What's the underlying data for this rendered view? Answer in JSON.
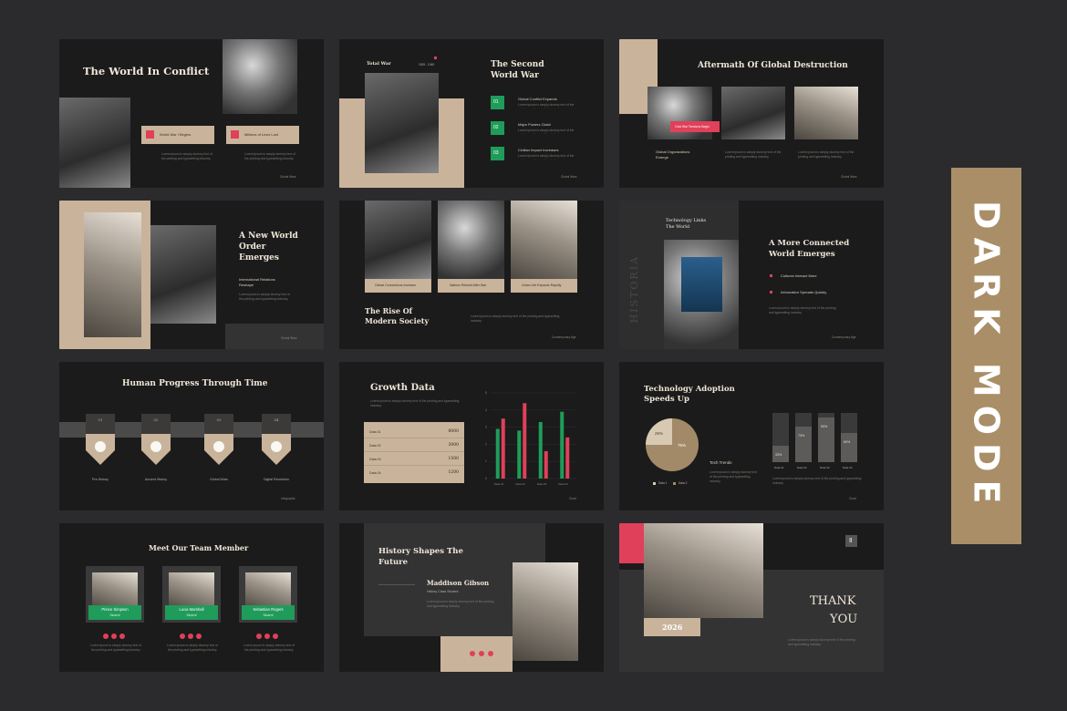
{
  "side_label": "DARK MODE",
  "s1": {
    "title": "The World In Conflict",
    "card1": "World War I Begins",
    "card2": "Millions of Lives Lost",
    "footer": "Global Wars"
  },
  "s2": {
    "tag": "Total War",
    "date": "1939 - 1945",
    "title_line1": "The Second",
    "title_line2": "World War",
    "items": [
      {
        "num": "01",
        "label": "Global Conflict Expands"
      },
      {
        "num": "02",
        "label": "Major Powers Clash"
      },
      {
        "num": "03",
        "label": "Civilian Impact Increases"
      }
    ],
    "footer": "Global Wars"
  },
  "s3": {
    "title": "Aftermath Of Global Destruction",
    "button": "Cold War Tensions Begin",
    "caption_line1": "Global Organizations",
    "caption_line2": "Emerge",
    "footer": "Global Wars"
  },
  "s4": {
    "title_line1": "A New World",
    "title_line2": "Order",
    "title_line3": "Emerges",
    "sub_line1": "International Relations",
    "sub_line2": "Reshape",
    "footer": "Global Wars"
  },
  "s5": {
    "cap1": "Global Connections Increase",
    "cap2": "Nations Rebuild After War",
    "cap3": "Urban Life Expands Rapidly",
    "title_line1": "The Rise Of",
    "title_line2": "Modern Society",
    "footer": "Contemporary Age"
  },
  "s6": {
    "head_line1": "Technology Links",
    "head_line2": "The World",
    "vertical": "HISTORIA",
    "title_line1": "A More Connected",
    "title_line2": "World Emerges",
    "b1": "Cultures Interact More",
    "b2": "Information Spreads Quickly",
    "footer": "Contemporary Age"
  },
  "s7": {
    "title": "Human Progress Through Time",
    "steps": [
      {
        "num": "01",
        "label": "Pre-History"
      },
      {
        "num": "02",
        "label": "Ancient History"
      },
      {
        "num": "03",
        "label": "Global Wars"
      },
      {
        "num": "04",
        "label": "Digital Revolution"
      }
    ],
    "footer": "Infographic"
  },
  "s8": {
    "title": "Growth Data",
    "rows": [
      {
        "label": "Data 01",
        "value": "8000"
      },
      {
        "label": "Data 02",
        "value": "3000"
      },
      {
        "label": "Data 03",
        "value": "1500"
      },
      {
        "label": "Data 04",
        "value": "1200"
      }
    ],
    "yticks": [
      "5",
      "4",
      "3",
      "2",
      "1",
      "0"
    ],
    "xcats": [
      "Data 01",
      "Data 02",
      "Data 03",
      "Data 04"
    ],
    "footer": "Chart",
    "bars": [
      {
        "green": 2.9,
        "red": 3.5
      },
      {
        "green": 2.8,
        "red": 4.4
      },
      {
        "green": 3.3,
        "red": 1.6
      },
      {
        "green": 3.9,
        "red": 2.4
      }
    ]
  },
  "s9": {
    "title_line1": "Technology Adoption",
    "title_line2": "Speeds Up",
    "pie_a": "25%",
    "pie_b": "75%",
    "legend1": "Data 1",
    "legend2": "Data 2",
    "trend": "Tech Trends",
    "cols": [
      {
        "pct": "33%",
        "label": "Data 01",
        "fill": 0.33
      },
      {
        "pct": "73%",
        "label": "Data 02",
        "fill": 0.73
      },
      {
        "pct": "90%",
        "label": "Data 03",
        "fill": 0.9
      },
      {
        "pct": "60%",
        "label": "Data 04",
        "fill": 0.6
      }
    ],
    "footer": "Chart"
  },
  "s10": {
    "title": "Meet Our Team Member",
    "members": [
      {
        "name": "Prince Simpson",
        "role": "Student"
      },
      {
        "name": "Lucia Marshall",
        "role": "Student"
      },
      {
        "name": "Sebastian Rogers",
        "role": "Student"
      }
    ]
  },
  "s11": {
    "title_line1": "History Shapes The",
    "title_line2": "Future",
    "name": "Maddison Gibson",
    "role": "History Class Student"
  },
  "s12": {
    "year": "2026",
    "title_line1": "THANK",
    "title_line2": "YOU"
  },
  "lorem": "Lorem ipsum is simply dummy text of the printing and typesetting industry.",
  "colors": {
    "background": "#2b2b2d",
    "slide": "#1b1b1b",
    "tan": "#c9b49b",
    "accent_red": "#e0405a",
    "accent_green": "#1f9c5a",
    "label_box": "#a98e67"
  }
}
